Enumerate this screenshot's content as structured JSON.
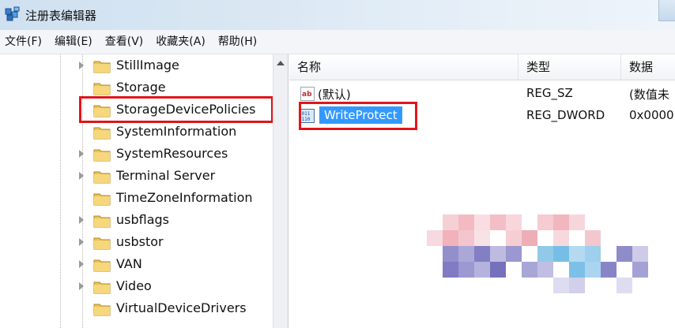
{
  "window": {
    "title": "注册表编辑器"
  },
  "menu": [
    {
      "label": "文件(F)"
    },
    {
      "label": "编辑(E)"
    },
    {
      "label": "查看(V)"
    },
    {
      "label": "收藏夹(A)"
    },
    {
      "label": "帮助(H)"
    }
  ],
  "tree": {
    "items": [
      {
        "label": "StillImage",
        "expandable": true
      },
      {
        "label": "Storage",
        "expandable": false
      },
      {
        "label": "StorageDevicePolicies",
        "expandable": false,
        "highlighted": true
      },
      {
        "label": "SystemInformation",
        "expandable": false
      },
      {
        "label": "SystemResources",
        "expandable": true
      },
      {
        "label": "Terminal Server",
        "expandable": true
      },
      {
        "label": "TimeZoneInformation",
        "expandable": false
      },
      {
        "label": "usbflags",
        "expandable": true
      },
      {
        "label": "usbstor",
        "expandable": true
      },
      {
        "label": "VAN",
        "expandable": true
      },
      {
        "label": "Video",
        "expandable": true
      },
      {
        "label": "VirtualDeviceDrivers",
        "expandable": false
      }
    ]
  },
  "list": {
    "columns": {
      "name": "名称",
      "type": "类型",
      "data": "数据"
    },
    "rows": [
      {
        "name": "(默认)",
        "type": "REG_SZ",
        "data": "(数值未",
        "icon": "string-value-icon"
      },
      {
        "name": "WriteProtect",
        "type": "REG_DWORD",
        "data": "0x0000",
        "icon": "binary-value-icon",
        "selected": true
      }
    ]
  },
  "colors": {
    "highlight_box": "#e0151b",
    "selection": "#3399ff",
    "titlebar": "#d9e7f3"
  }
}
